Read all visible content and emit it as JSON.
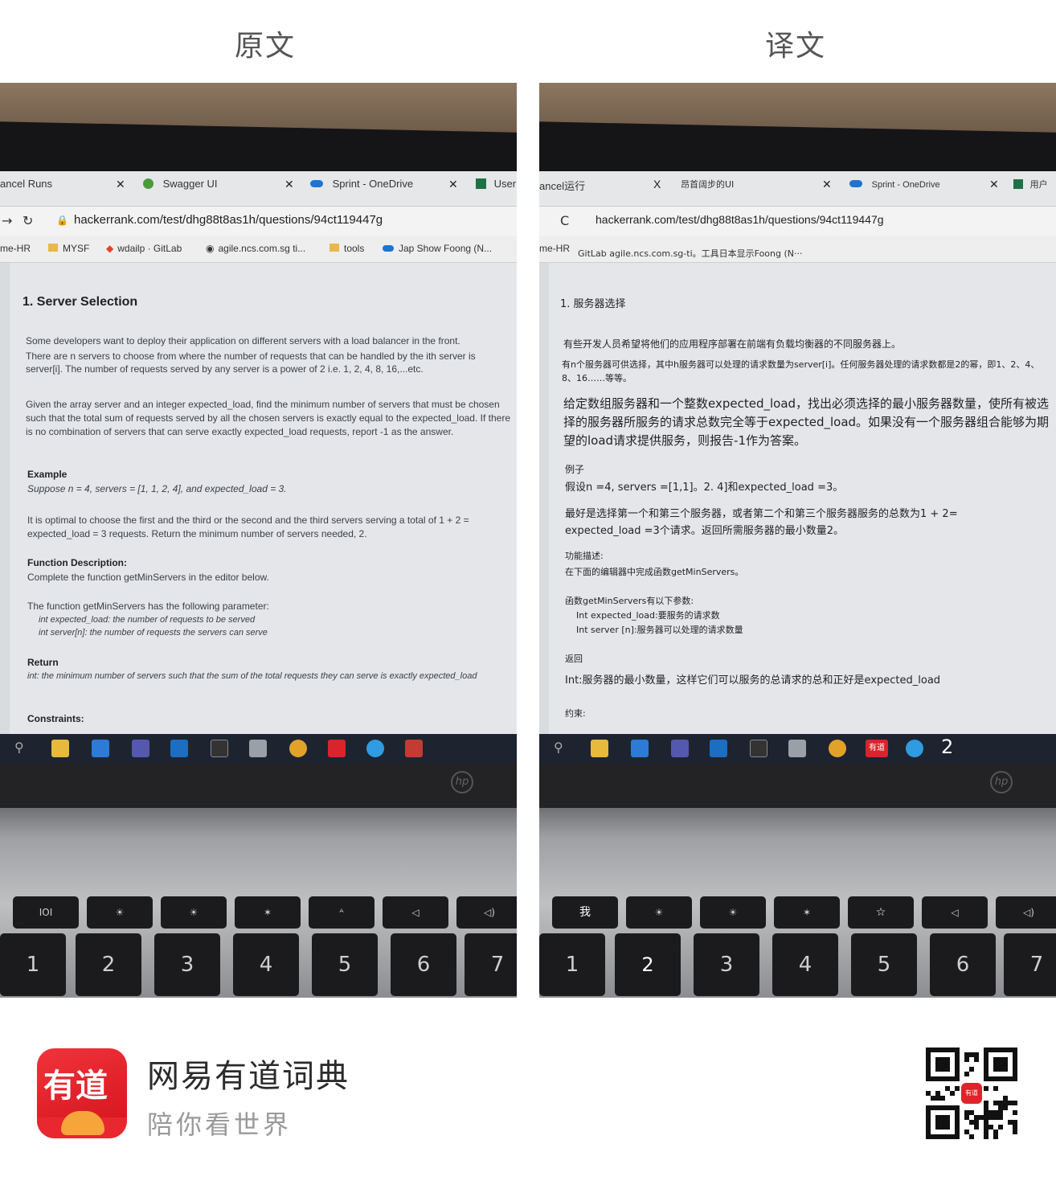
{
  "header": {
    "left_label": "原文",
    "right_label": "译文"
  },
  "original": {
    "tabs": [
      {
        "label": "ancel Runs"
      },
      {
        "label": "Swagger UI"
      },
      {
        "label": "Sprint - OneDrive"
      },
      {
        "label": "User"
      }
    ],
    "url": "hackerrank.com/test/dhg88t8as1h/questions/94ct119447g",
    "bookmarks": [
      "me-HR",
      "MYSF",
      "wdailp · GitLab",
      "agile.ncs.com.sg ti...",
      "tools",
      "Jap Show Foong (N..."
    ],
    "title": "1. Server Selection",
    "para1": "Some developers want to deploy their application on different servers with a load balancer in the front.",
    "para2": "There are n servers to choose from where the number of requests that can be handled by the ith server is server[i]. The number of requests served by any server is a power of 2 i.e. 1, 2, 4, 8, 16,...etc.",
    "para3": "Given the array server and an integer expected_load, find the minimum number of servers that must be chosen such that the total sum of requests served by all the chosen servers is exactly equal to the expected_load. If there is no combination of servers that can serve exactly expected_load requests, report -1 as the answer.",
    "example_heading": "Example",
    "example_line": "Suppose n = 4, servers = [1, 1, 2, 4], and expected_load = 3.",
    "example_explain": "It is optimal to choose the first and the third or the second and the third servers serving a total of 1 + 2 = expected_load = 3 requests. Return the minimum number of servers needed, 2.",
    "func_heading": "Function Description:",
    "func_line": "Complete the function getMinServers in the editor below.",
    "param_line": "The function getMinServers has the following parameter:",
    "param1": "int expected_load: the number of requests to be served",
    "param2": "int server[n]: the number of requests the servers can serve",
    "return_heading": "Return",
    "return_line": "int: the minimum number of servers such that the sum of the total requests they can serve is exactly expected_load",
    "constraints_heading": "Constraints:"
  },
  "translated": {
    "tabs": [
      {
        "label": "ancel运行"
      },
      {
        "label": "昂首阔步的UI"
      },
      {
        "label": "Sprint - OneDrive"
      },
      {
        "label": "用户"
      }
    ],
    "nav_label": "C",
    "url": "hackerrank.com/test/dhg88t8as1h/questions/94ct119447g",
    "bookmark_left": "me-HR",
    "bookmarks_line": "GitLab agile.ncs.com.sg-ti。工具日本显示Foong (N···",
    "title": "1. 服务器选择",
    "para1": "有些开发人员希望将他们的应用程序部署在前端有负载均衡器的不同服务器上。",
    "para2": "有n个服务器可供选择，其中h服务器可以处理的请求数量为server[i]。任何服务器处理的请求数都是2的幂，即1、2、4、8、16……等等。",
    "para3": "给定数组服务器和一个整数expected_load，找出必须选择的最小服务器数量，使所有被选择的服务器所服务的请求总数完全等于expected_load。如果没有一个服务器组合能够为期望的load请求提供服务，则报告-1作为答案。",
    "example_heading": "例子",
    "example_line": "假设n =4, servers =[1,1]。2. 4]和expected_load =3。",
    "example_explain": "最好是选择第一个和第三个服务器，或者第二个和第三个服务器服务的总数为1 + 2= expected_load =3个请求。返回所需服务器的最小数量2。",
    "func_heading": "功能描述:",
    "func_line": "在下面的编辑器中完成函数getMinServers。",
    "param_line": "函数getMinServers有以下参数:",
    "param1": "Int expected_load:要服务的请求数",
    "param2": "Int server [n]:服务器可以处理的请求数量",
    "return_heading": "返回",
    "return_line": "Int:服务器的最小数量，这样它们可以服务的总请求的总和正好是expected_load",
    "constraints_heading": "约束:",
    "taskbar_badge": "有道",
    "taskbar_number": "2",
    "key_label_wo": "我",
    "key_label_two": "2",
    "key_label_star": "☆"
  },
  "keys": {
    "row_fn": [
      "IOI",
      "☀",
      "☀",
      "✶",
      "ᴬ",
      "◁",
      "◁)"
    ],
    "row_num": [
      "1",
      "2",
      "3",
      "4",
      "5",
      "6",
      "7"
    ],
    "row_sym": [
      "!",
      "@",
      "#",
      "$",
      "%",
      "^",
      "&"
    ]
  },
  "footer": {
    "app_name": "网易有道词典",
    "slogan": "陪你看世界",
    "logo_text": "有道",
    "qr_center_text": "有道"
  }
}
